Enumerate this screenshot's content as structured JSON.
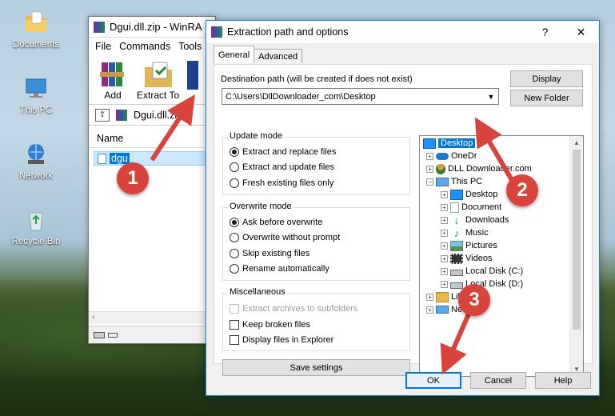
{
  "desktop": {
    "icons": [
      {
        "label": "Documents",
        "icon": "folder-icon"
      },
      {
        "label": "This PC",
        "icon": "computer-icon"
      },
      {
        "label": "Network",
        "icon": "network-icon"
      },
      {
        "label": "Recycle Bin",
        "icon": "recycle-bin-icon"
      }
    ]
  },
  "winrar": {
    "title": "Dgui.dll.zip - WinRA",
    "menu": [
      "File",
      "Commands",
      "Tools"
    ],
    "toolbar": {
      "add": "Add",
      "extract_to": "Extract To"
    },
    "path": "Dgui.dll.zip",
    "column_name": "Name",
    "file": "dgu"
  },
  "dialog": {
    "title": "Extraction path and options",
    "help": "?",
    "close": "✕",
    "tabs": [
      "General",
      "Advanced"
    ],
    "destination_label": "Destination path (will be created if does not exist)",
    "destination_value": "C:\\Users\\DllDownloader_com\\Desktop",
    "buttons": {
      "display": "Display",
      "new_folder": "New Folder",
      "save_settings": "Save settings",
      "ok": "OK",
      "cancel": "Cancel",
      "help": "Help"
    },
    "update_mode": {
      "title": "Update mode",
      "options": [
        "Extract and replace files",
        "Extract and update files",
        "Fresh existing files only"
      ],
      "selected": 0
    },
    "overwrite_mode": {
      "title": "Overwrite mode",
      "options": [
        "Ask before overwrite",
        "Overwrite without prompt",
        "Skip existing files",
        "Rename automatically"
      ],
      "selected": 0
    },
    "misc": {
      "title": "Miscellaneous",
      "options": [
        "Extract archives to subfolders",
        "Keep broken files",
        "Display files in Explorer"
      ]
    },
    "tree": [
      "Desktop",
      "OneDr",
      "DLL Downloader.com",
      "This PC",
      "Desktop",
      "Document",
      "Downloads",
      "Music",
      "Pictures",
      "Videos",
      "Local Disk (C:)",
      "Local Disk (D:)",
      "Libraries",
      "Ne"
    ]
  },
  "annotations": {
    "steps": [
      "1",
      "2",
      "3"
    ],
    "color": "#d8433b"
  }
}
